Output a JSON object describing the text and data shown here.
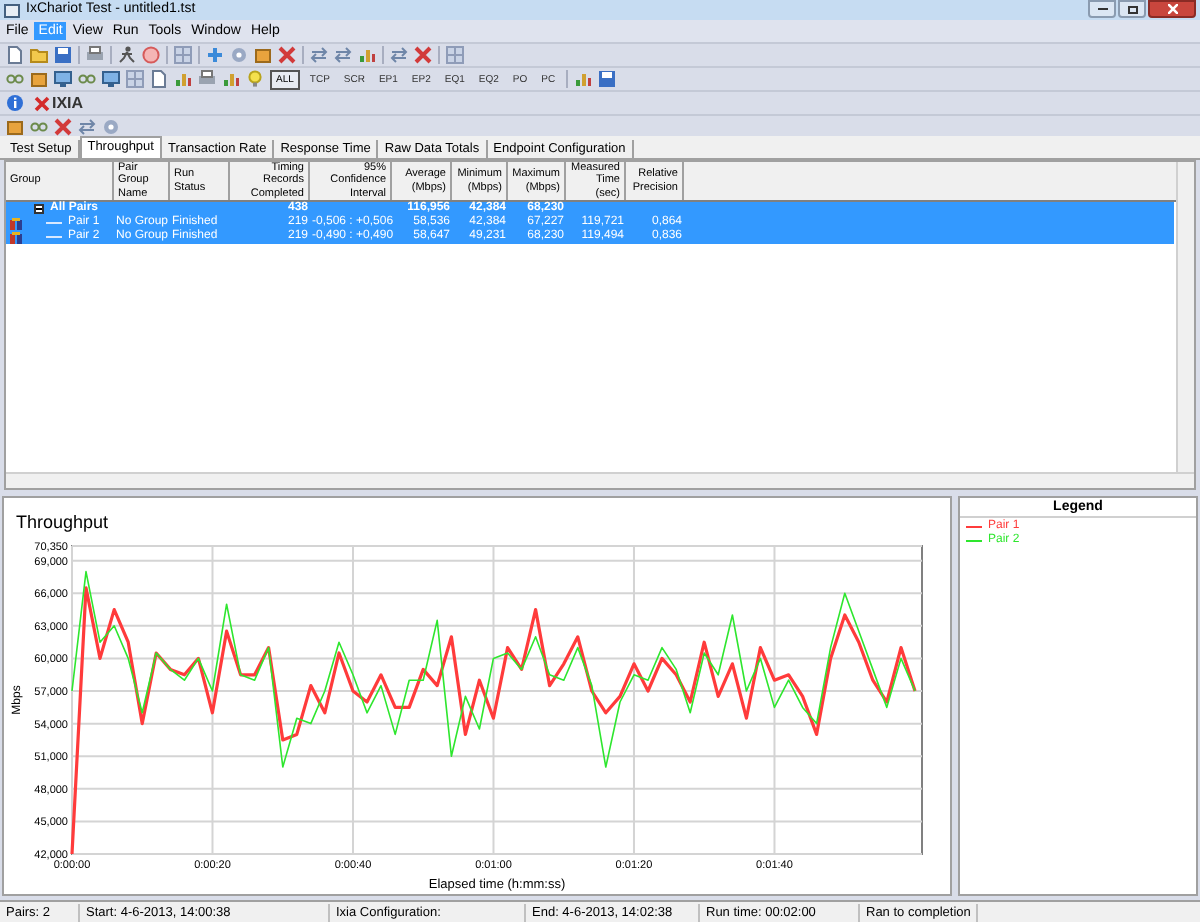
{
  "window": {
    "title": "IxChariot Test - untitled1.tst"
  },
  "menu": [
    {
      "label": "File",
      "selected": false
    },
    {
      "label": "Edit",
      "selected": true
    },
    {
      "label": "View",
      "selected": false
    },
    {
      "label": "Run",
      "selected": false
    },
    {
      "label": "Tools",
      "selected": false
    },
    {
      "label": "Window",
      "selected": false
    },
    {
      "label": "Help",
      "selected": false
    }
  ],
  "filters": [
    {
      "label": "ALL",
      "selected": true
    },
    {
      "label": "TCP",
      "selected": false
    },
    {
      "label": "SCR",
      "selected": false
    },
    {
      "label": "EP1",
      "selected": false
    },
    {
      "label": "EP2",
      "selected": false
    },
    {
      "label": "EQ1",
      "selected": false
    },
    {
      "label": "EQ2",
      "selected": false
    },
    {
      "label": "PO",
      "selected": false
    },
    {
      "label": "PC",
      "selected": false
    }
  ],
  "logo": "IXIA",
  "tabs": [
    {
      "label": "Test Setup",
      "selected": false
    },
    {
      "label": "Throughput",
      "selected": true
    },
    {
      "label": "Transaction Rate",
      "selected": false
    },
    {
      "label": "Response Time",
      "selected": false
    },
    {
      "label": "Raw Data Totals",
      "selected": false
    },
    {
      "label": "Endpoint Configuration",
      "selected": false
    }
  ],
  "table": {
    "columns": [
      "Group",
      "Pair Group Name",
      "Run Status",
      "Timing Records Completed",
      "95% Confidence Interval",
      "Average (Mbps)",
      "Minimum (Mbps)",
      "Maximum (Mbps)",
      "Measured Time (sec)",
      "Relative Precision"
    ],
    "rows": [
      {
        "kind": "group",
        "expanded": true,
        "selected": true,
        "cells": [
          "All Pairs",
          "",
          "",
          "438",
          "",
          "116,956",
          "42,384",
          "68,230",
          "",
          ""
        ]
      },
      {
        "kind": "pair",
        "selected": true,
        "cells": [
          "Pair 1",
          "No Group",
          "Finished",
          "219",
          "-0,506 : +0,506",
          "58,536",
          "42,384",
          "67,227",
          "119,721",
          "0,864"
        ]
      },
      {
        "kind": "pair",
        "selected": true,
        "cells": [
          "Pair 2",
          "No Group",
          "Finished",
          "219",
          "-0,490 : +0,490",
          "58,647",
          "49,231",
          "68,230",
          "119,494",
          "0,836"
        ]
      }
    ]
  },
  "chart": {
    "chart_data": {
      "type": "line",
      "title": "Throughput",
      "xlabel": "Elapsed time (h:mm:ss)",
      "ylabel": "Mbps",
      "x": [
        0,
        2,
        4,
        6,
        8,
        10,
        12,
        14,
        16,
        18,
        20,
        22,
        24,
        26,
        28,
        30,
        32,
        34,
        36,
        38,
        40,
        42,
        44,
        46,
        48,
        50,
        52,
        54,
        56,
        58,
        60,
        62,
        64,
        66,
        68,
        70,
        72,
        74,
        76,
        78,
        80,
        82,
        84,
        86,
        88,
        90,
        92,
        94,
        96,
        98,
        100,
        102,
        104,
        106,
        108,
        110,
        112,
        114,
        116,
        118,
        120
      ],
      "series": [
        {
          "name": "Pair 1",
          "color": "#ff3b3b",
          "values": [
            42.0,
            66.5,
            60.0,
            64.5,
            61.5,
            54.0,
            60.5,
            59.0,
            58.5,
            60.0,
            55.0,
            62.5,
            58.5,
            58.5,
            61.0,
            52.5,
            53.0,
            57.5,
            55.0,
            60.5,
            57.0,
            56.0,
            58.5,
            55.5,
            55.5,
            59.0,
            57.5,
            62.0,
            53.0,
            58.0,
            54.5,
            61.0,
            59.0,
            64.5,
            57.5,
            59.5,
            62.0,
            57.0,
            55.0,
            56.5,
            59.5,
            57.0,
            60.0,
            58.5,
            56.0,
            61.5,
            56.5,
            59.5,
            54.5,
            61.0,
            58.0,
            58.5,
            56.5,
            53.0,
            60.0,
            64.0,
            61.5,
            58.0,
            56.0,
            61.0,
            57.0
          ]
        },
        {
          "name": "Pair 2",
          "color": "#2ee62e",
          "values": [
            57.0,
            68.0,
            61.5,
            63.0,
            60.0,
            55.0,
            60.5,
            59.0,
            58.0,
            60.0,
            57.0,
            65.0,
            58.5,
            58.0,
            61.0,
            50.0,
            54.5,
            54.0,
            57.0,
            61.5,
            58.5,
            55.0,
            57.5,
            53.0,
            58.0,
            58.0,
            63.5,
            51.0,
            56.5,
            53.5,
            60.0,
            60.5,
            59.0,
            62.0,
            58.5,
            58.0,
            61.0,
            57.5,
            50.0,
            56.0,
            58.5,
            58.0,
            61.0,
            59.0,
            55.0,
            60.5,
            58.5,
            64.0,
            57.0,
            60.0,
            55.5,
            58.0,
            55.5,
            54.0,
            61.0,
            66.0,
            62.5,
            59.0,
            55.5,
            60.0,
            57.0
          ]
        }
      ],
      "grid": true,
      "xlim": [
        0,
        121
      ],
      "ylim": [
        42,
        70.35
      ],
      "xticks": [
        {
          "value": 0,
          "label": "0:00:00"
        },
        {
          "value": 20,
          "label": "0:00:20"
        },
        {
          "value": 40,
          "label": "0:00:40"
        },
        {
          "value": 60,
          "label": "0:01:00"
        },
        {
          "value": 80,
          "label": "0:01:20"
        },
        {
          "value": 100,
          "label": "0:01:40"
        }
      ],
      "yticks": [
        {
          "value": 42,
          "label": "42,000"
        },
        {
          "value": 45,
          "label": "45,000"
        },
        {
          "value": 48,
          "label": "48,000"
        },
        {
          "value": 51,
          "label": "51,000"
        },
        {
          "value": 54,
          "label": "54,000"
        },
        {
          "value": 57,
          "label": "57,000"
        },
        {
          "value": 60,
          "label": "60,000"
        },
        {
          "value": 63,
          "label": "63,000"
        },
        {
          "value": 66,
          "label": "66,000"
        },
        {
          "value": 69,
          "label": "69,000"
        },
        {
          "value": 70.35,
          "label": "70,350"
        }
      ]
    }
  },
  "legend": {
    "title": "Legend"
  },
  "status_bar": [
    "Pairs: 2",
    "Start: 4-6-2013, 14:00:38",
    "Ixia Configuration:",
    "End: 4-6-2013, 14:02:38",
    "Run time: 00:02:00",
    "Ran to completion"
  ]
}
